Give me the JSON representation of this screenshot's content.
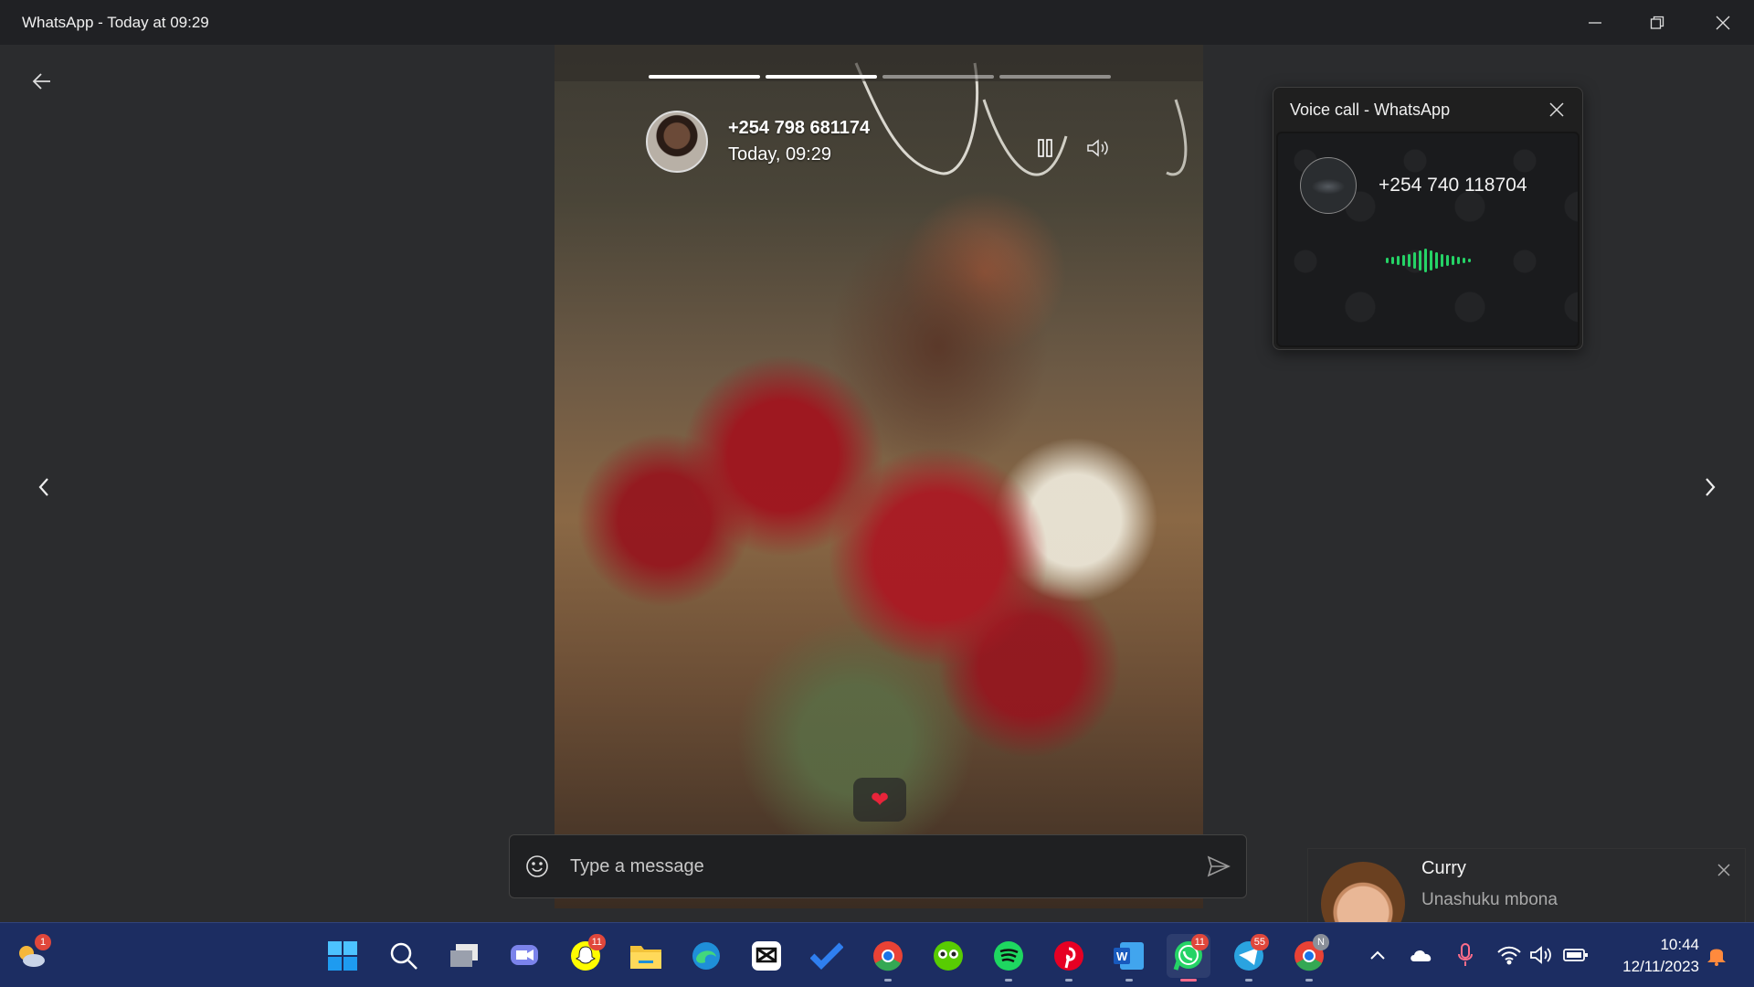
{
  "window": {
    "title": "WhatsApp - Today at 09:29"
  },
  "story": {
    "contact": "+254 798 681174",
    "time": "Today, 09:29",
    "segments_total": 4,
    "segments_done": 2,
    "reaction": "❤",
    "composer_placeholder": "Type a message"
  },
  "call": {
    "title": "Voice call - WhatsApp",
    "number": "+254 740 118704"
  },
  "toast": {
    "name": "Curry",
    "message": "Unashuku mbona"
  },
  "taskbar": {
    "weather_badge": "1",
    "snapchat_badge": "11",
    "whatsapp_badge": "11",
    "telegram_badge": "55",
    "chrome_profile_badge": "N",
    "time": "10:44",
    "date": "12/11/2023"
  },
  "colors": {
    "accent": "#25d366",
    "taskbar": "#1c2d62",
    "background": "#2b2c2e"
  }
}
